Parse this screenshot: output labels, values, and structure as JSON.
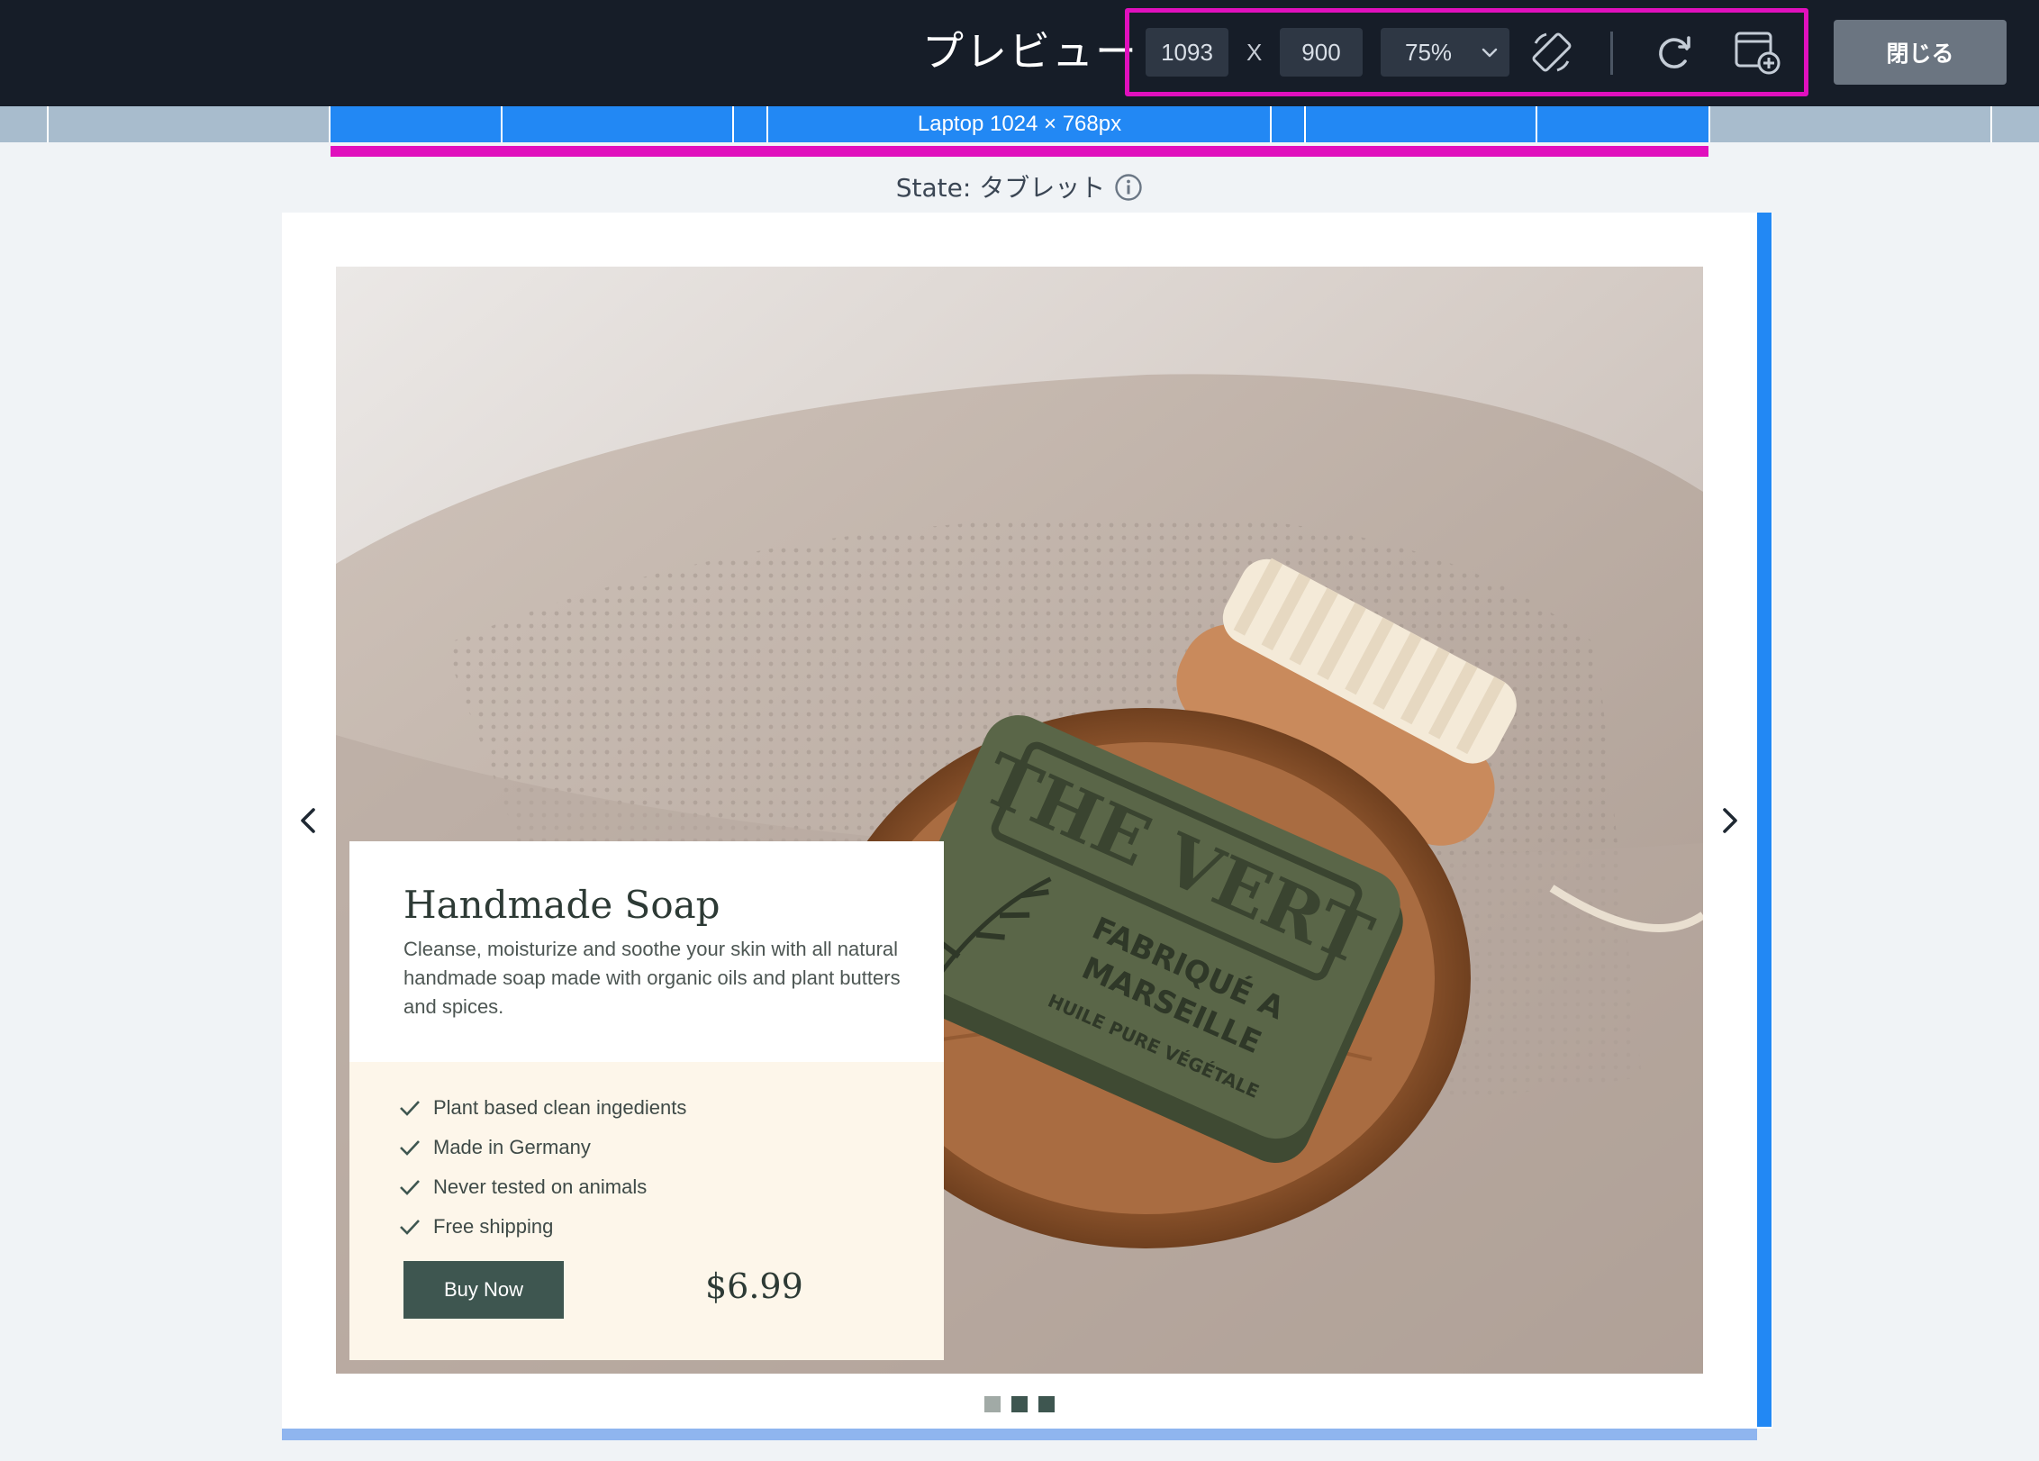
{
  "header": {
    "title": "プレビュー",
    "width_value": "1093",
    "height_value": "900",
    "times_label": "X",
    "zoom": "75%",
    "close_label": "閉じる"
  },
  "breakpoints": {
    "active_label": "Laptop 1024 × 768px"
  },
  "state": {
    "label": "State: タブレット"
  },
  "hero": {
    "title": "Handmade Soap",
    "description": "Cleanse, moisturize and soothe your skin with all natural handmade soap made with organic oils and plant butters and spices.",
    "features": [
      "Plant based clean ingedients",
      "Made in Germany",
      "Never tested on animals",
      "Free shipping"
    ],
    "buy_label": "Buy Now",
    "price": "$6.99",
    "soap_brand": "THE VERT",
    "soap_text_1": "FABRIQUÉ A",
    "soap_text_2": "MARSEILLE",
    "soap_text_3": "HUILE PURE VÉGÉTALE"
  },
  "carousel": {
    "active_index": 1,
    "slide_count": 3
  },
  "colors": {
    "accent_blue": "#2288f4",
    "highlight_magenta": "#e010bd",
    "button_green": "#3e5650"
  }
}
